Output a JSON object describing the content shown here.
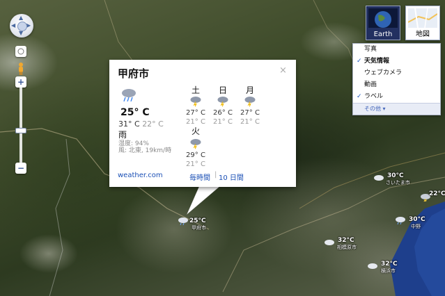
{
  "map_types": {
    "earth_label": "Earth",
    "map_label": "地図"
  },
  "layers": {
    "items": [
      {
        "label": "写真",
        "checked": false
      },
      {
        "label": "天気情報",
        "checked": true
      },
      {
        "label": "ウェブカメラ",
        "checked": false
      },
      {
        "label": "動画",
        "checked": false
      },
      {
        "label": "ラベル",
        "checked": true
      }
    ],
    "more_label": "その他 ▾"
  },
  "info": {
    "city": "甲府市",
    "close": "×",
    "current": {
      "temp": "25° C",
      "high": "31° C",
      "low": "22° C",
      "condition": "雨",
      "humidity": "湿度: 94%",
      "wind": "風: 北東, 19km/時",
      "icon": "rain-cloud-icon"
    },
    "forecast": [
      {
        "day": "土",
        "high": "27° C",
        "low": "21° C",
        "icon": "thunderstorm-icon"
      },
      {
        "day": "日",
        "high": "26° C",
        "low": "21° C",
        "icon": "thunderstorm-icon"
      },
      {
        "day": "月",
        "high": "27° C",
        "low": "21° C",
        "icon": "thunderstorm-icon"
      },
      {
        "day": "火",
        "high": "29° C",
        "low": "21° C",
        "icon": "thunderstorm-icon"
      }
    ],
    "source_link": "weather.com",
    "hourly_link": "毎時間",
    "separator": "|",
    "ten_day_link": "10 日間"
  },
  "map_markers": [
    {
      "temp": "25°C",
      "place": "甲府市",
      "icon": "rain-cloud-icon"
    },
    {
      "temp": "30°C",
      "place": "さいたま市",
      "icon": "cloud-icon"
    },
    {
      "temp": "22°C",
      "place": "",
      "icon": "thunderstorm-icon"
    },
    {
      "temp": "30°C",
      "place": "中野",
      "icon": "rain-cloud-icon"
    },
    {
      "temp": "32°C",
      "place": "相模原市",
      "icon": "cloud-icon"
    },
    {
      "temp": "32°C",
      "place": "横浜市",
      "icon": "cloud-icon"
    }
  ],
  "colors": {
    "link": "#1a4fb5",
    "check": "#1a55c0",
    "sea": "#1e3f8c"
  }
}
